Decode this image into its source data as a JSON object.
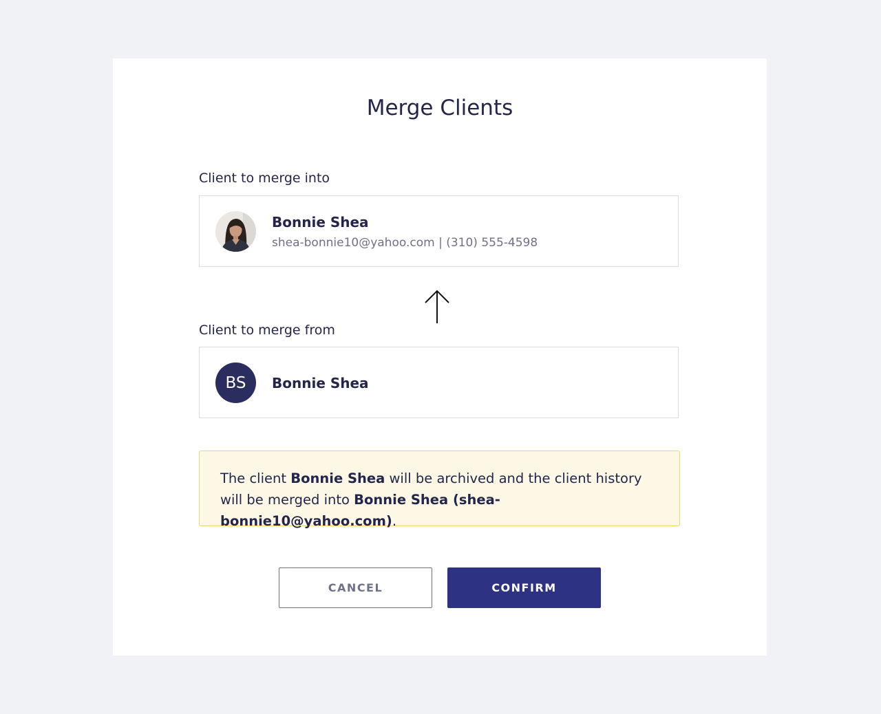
{
  "dialog": {
    "title": "Merge Clients"
  },
  "merge_into": {
    "label": "Client to merge into",
    "name": "Bonnie Shea",
    "meta": "shea-bonnie10@yahoo.com | (310) 555-4598",
    "avatar": "photo"
  },
  "merge_from": {
    "label": "Client to merge from",
    "name": "Bonnie Shea",
    "initials": "BS"
  },
  "notice": {
    "prefix": "The client ",
    "archived_name": "Bonnie Shea",
    "middle": " will be archived and the client history will be merged into ",
    "target": "Bonnie Shea (shea-bonnie10@yahoo.com)",
    "suffix": "."
  },
  "actions": {
    "cancel_label": "CANCEL",
    "confirm_label": "CONFIRM"
  },
  "colors": {
    "background": "#f0f2f5",
    "text": "#23254a",
    "muted": "#6e7187",
    "primary": "#2d3283",
    "notice_bg": "#fdf8e6",
    "notice_border": "#f2d86a"
  }
}
